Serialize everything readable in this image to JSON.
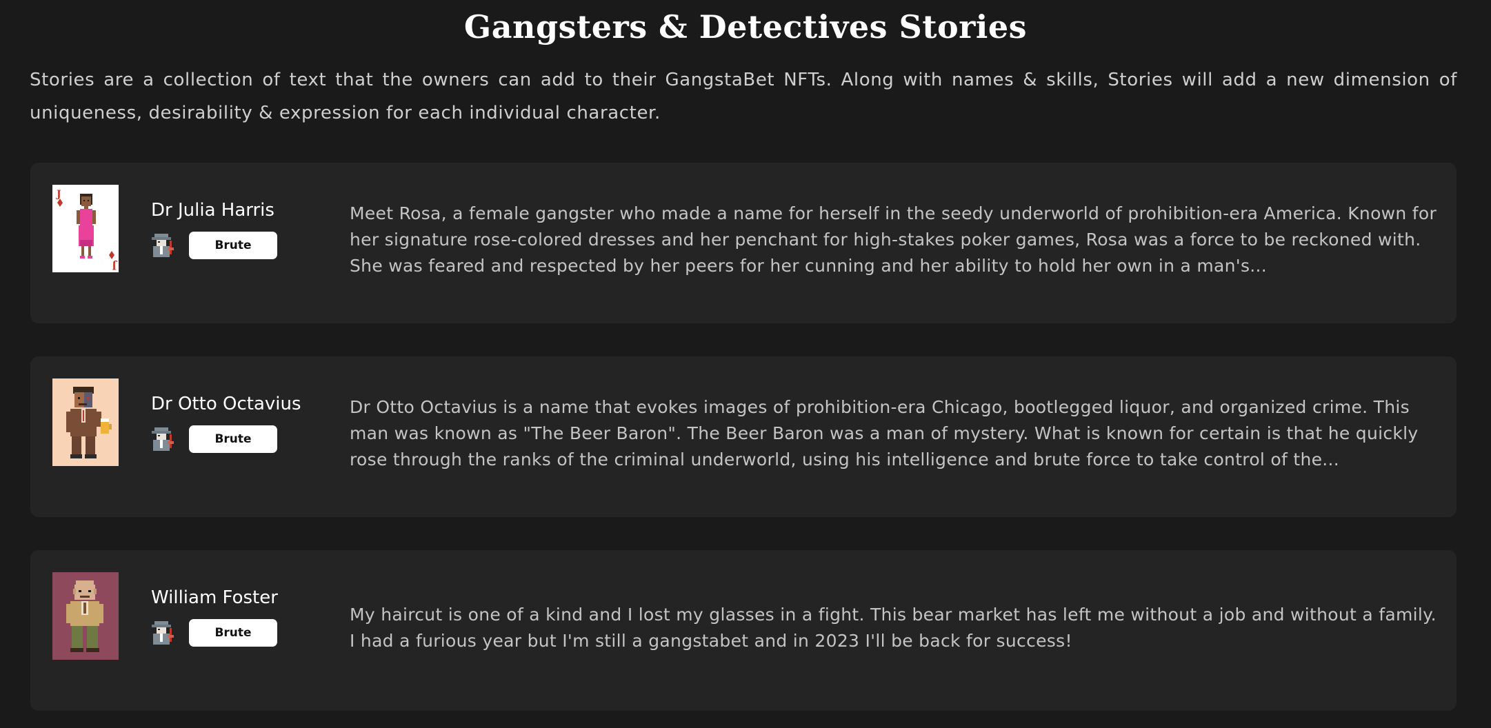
{
  "header": {
    "title": "Gangsters & Detectives Stories",
    "intro": "Stories are a collection of text that the owners can add to their GangstaBet NFTs. Along with names & skills, Stories will add a new dimension of uniqueness, desirability & expression for each individual character."
  },
  "stories": [
    {
      "name": "Dr Julia Harris",
      "skill": "Brute",
      "skill_icon": "detective-icon",
      "portrait": "jack-of-diamonds-card-portrait",
      "text": "Meet Rosa, a female gangster who made a name for herself in the seedy underworld of prohibition-era America. Known for her signature rose-colored dresses and her penchant for high-stakes poker games, Rosa was a force to be reckoned with. She was feared and respected by her peers for her cunning and her ability to hold her own in a man's..."
    },
    {
      "name": "Dr Otto Octavius",
      "skill": "Brute",
      "skill_icon": "detective-icon",
      "portrait": "beer-baron-portrait",
      "text": "Dr Otto Octavius is a name that evokes images of prohibition-era Chicago, bootlegged liquor, and organized crime. This man was known as \"The Beer Baron\". The Beer Baron was a man of mystery. What is known for certain is that he quickly rose through the ranks of the criminal underworld, using his intelligence and brute force to take control of the..."
    },
    {
      "name": "William Foster",
      "skill": "Brute",
      "skill_icon": "detective-icon",
      "portrait": "bald-gangster-portrait",
      "text": "My haircut is one of a kind and I lost my glasses in a fight. This bear market has left me without a job and without a family. I had a furious year but I'm still a gangstabet and in 2023 I'll be back for success!"
    }
  ],
  "colors": {
    "background": "#1a1a1a",
    "card": "#242424",
    "portrait_bg_card": "#ffffff",
    "portrait_bg_peach": "#f8d3b6",
    "portrait_bg_mauve": "#8e4a5c",
    "card_suit_red": "#c0392b",
    "dress_pink": "#e8429a"
  }
}
